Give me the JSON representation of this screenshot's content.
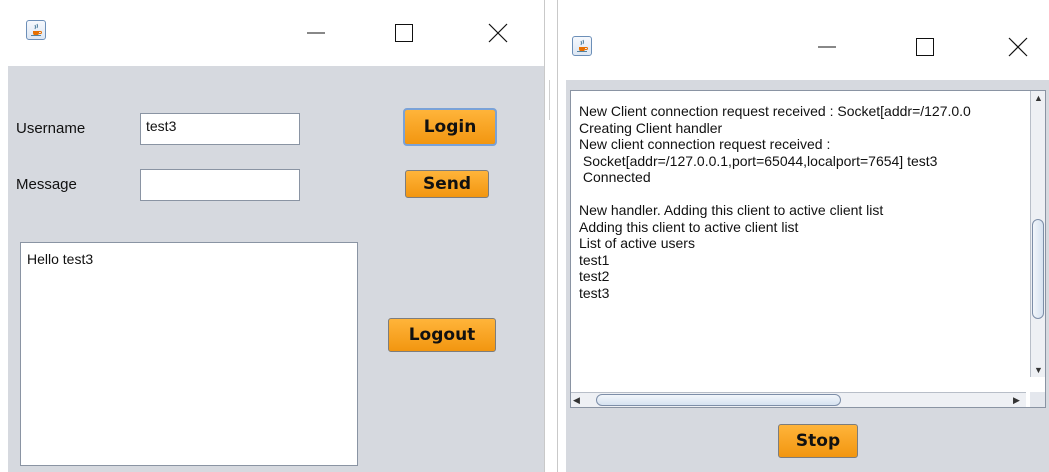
{
  "client_window": {
    "form": {
      "username_label": "Username",
      "username_value": "test3",
      "message_label": "Message",
      "message_value": ""
    },
    "buttons": {
      "login": "Login",
      "send": "Send",
      "logout": "Logout"
    },
    "chat_text": "Hello test3"
  },
  "server_window": {
    "log_lines": [
      "New Client connection request received : Socket[addr=/127.0.0",
      "Creating Client handler",
      "New client connection request received :",
      " Socket[addr=/127.0.0.1,port=65044,localport=7654] test3",
      " Connected",
      "",
      "New handler. Adding this client to active client list",
      "Adding this client to active client list",
      "List of active users",
      "test1",
      "test2",
      "test3"
    ],
    "stop_label": "Stop"
  },
  "colors": {
    "button_orange": "#f29610",
    "client_bg": "#d6d9df"
  },
  "icons": [
    "java-icon",
    "minimize-icon",
    "maximize-icon",
    "close-icon",
    "scroll-up-icon",
    "scroll-down-icon",
    "scroll-left-icon",
    "scroll-right-icon"
  ]
}
